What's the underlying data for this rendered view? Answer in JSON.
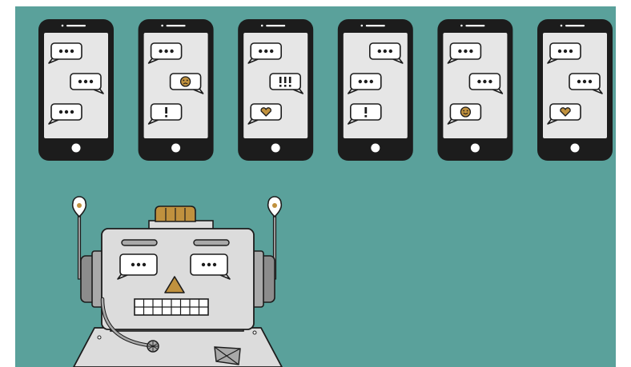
{
  "colors": {
    "background": "#5aa19b",
    "border": "#ffffff",
    "phone_body": "#1c1c1c",
    "phone_screen": "#e6e6e6",
    "bubble_fill": "#ffffff",
    "outline": "#1c1c1c",
    "accent": "#c0913e",
    "robot_face": "#dcdcdc",
    "robot_gray": "#a9a9a9",
    "robot_dark_gray": "#8c8c8c"
  },
  "phones": [
    {
      "bubbles": [
        {
          "side": "left",
          "icon": "ellipsis"
        },
        {
          "side": "right",
          "icon": "ellipsis"
        },
        {
          "side": "left",
          "icon": "ellipsis"
        }
      ]
    },
    {
      "bubbles": [
        {
          "side": "left",
          "icon": "ellipsis"
        },
        {
          "side": "right",
          "icon": "sad-face"
        },
        {
          "side": "left",
          "icon": "exclamation"
        }
      ]
    },
    {
      "bubbles": [
        {
          "side": "left",
          "icon": "ellipsis"
        },
        {
          "side": "right",
          "icon": "triple-exclamation"
        },
        {
          "side": "left",
          "icon": "heart"
        }
      ]
    },
    {
      "bubbles": [
        {
          "side": "right",
          "icon": "ellipsis"
        },
        {
          "side": "left",
          "icon": "ellipsis"
        },
        {
          "side": "left",
          "icon": "exclamation"
        }
      ]
    },
    {
      "bubbles": [
        {
          "side": "left",
          "icon": "ellipsis"
        },
        {
          "side": "right",
          "icon": "ellipsis"
        },
        {
          "side": "left",
          "icon": "happy-face"
        }
      ]
    },
    {
      "bubbles": [
        {
          "side": "left",
          "icon": "ellipsis"
        },
        {
          "side": "right",
          "icon": "ellipsis"
        },
        {
          "side": "left",
          "icon": "heart"
        }
      ]
    }
  ],
  "robot": {
    "eye_bubbles": [
      "ellipsis",
      "ellipsis"
    ],
    "parts": [
      "antenna-left",
      "antenna-right",
      "head",
      "ear-left",
      "ear-right",
      "nose",
      "mouth-grille",
      "microphone-headset",
      "body"
    ]
  }
}
